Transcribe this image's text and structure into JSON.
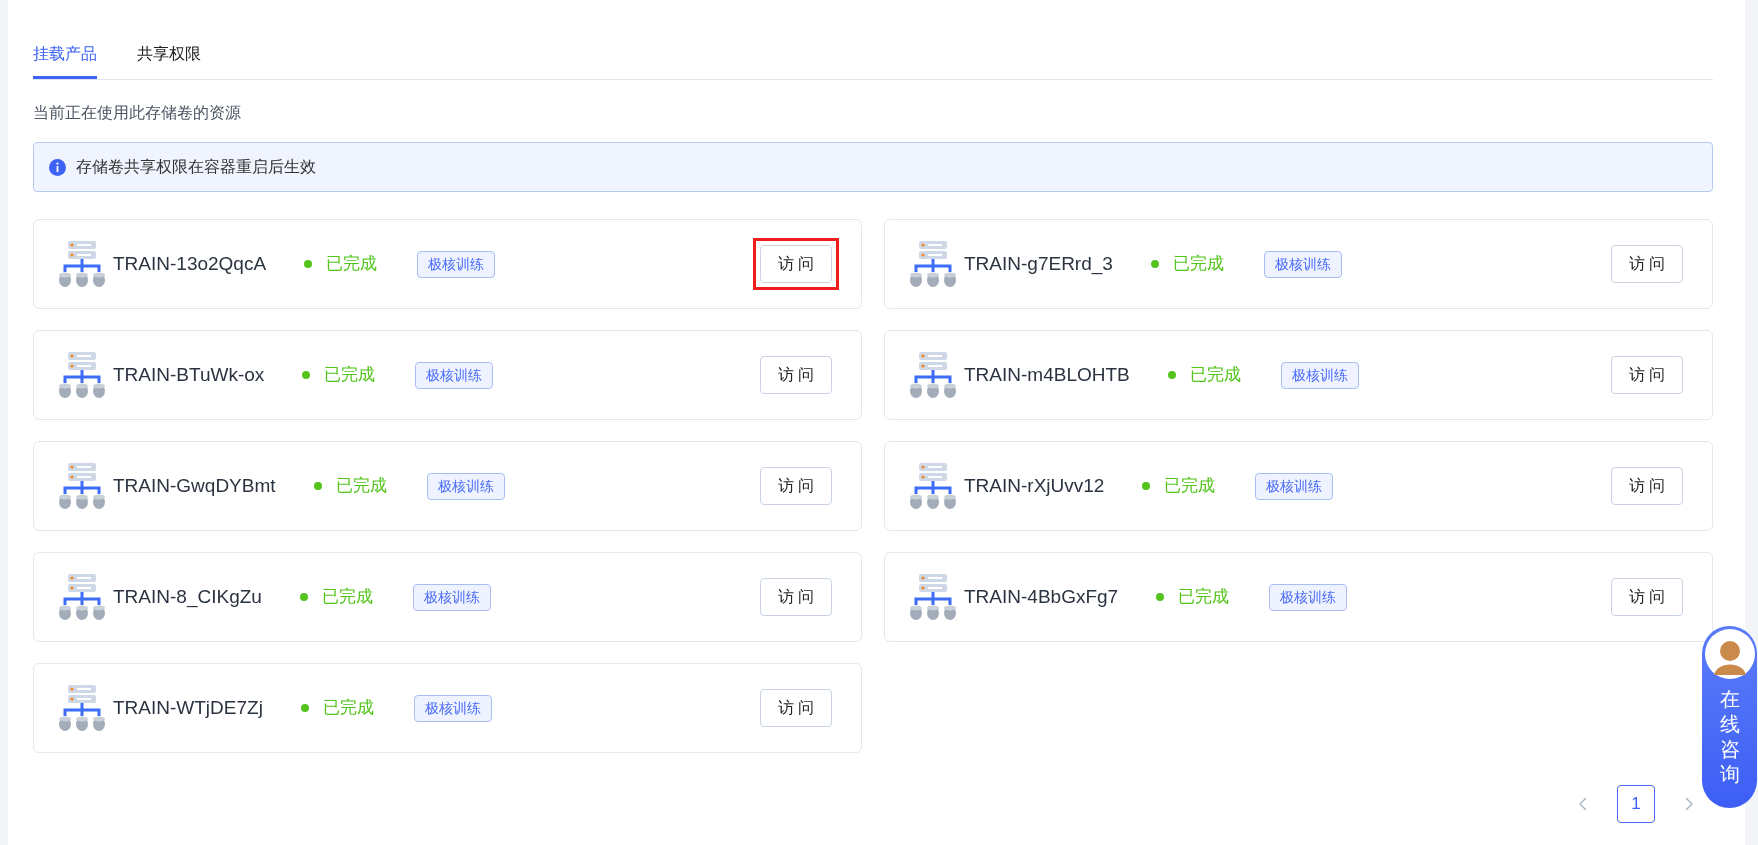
{
  "tabs": [
    {
      "label": "挂载产品",
      "selected": true
    },
    {
      "label": "共享权限",
      "selected": false
    }
  ],
  "subtitle": "当前正在使用此存储卷的资源",
  "alert": {
    "text": "存储卷共享权限在容器重启后生效"
  },
  "resources": [
    {
      "name": "TRAIN-13o2QqcA",
      "status": "已完成",
      "tag": "极核训练",
      "button": "访 问",
      "highlighted": true
    },
    {
      "name": "TRAIN-g7ERrd_3",
      "status": "已完成",
      "tag": "极核训练",
      "button": "访 问",
      "highlighted": false
    },
    {
      "name": "TRAIN-BTuWk-ox",
      "status": "已完成",
      "tag": "极核训练",
      "button": "访 问",
      "highlighted": false
    },
    {
      "name": "TRAIN-m4BLOHTB",
      "status": "已完成",
      "tag": "极核训练",
      "button": "访 问",
      "highlighted": false
    },
    {
      "name": "TRAIN-GwqDYBmt",
      "status": "已完成",
      "tag": "极核训练",
      "button": "访 问",
      "highlighted": false
    },
    {
      "name": "TRAIN-rXjUvv12",
      "status": "已完成",
      "tag": "极核训练",
      "button": "访 问",
      "highlighted": false
    },
    {
      "name": "TRAIN-8_CIKgZu",
      "status": "已完成",
      "tag": "极核训练",
      "button": "访 问",
      "highlighted": false
    },
    {
      "name": "TRAIN-4BbGxFg7",
      "status": "已完成",
      "tag": "极核训练",
      "button": "访 问",
      "highlighted": false
    },
    {
      "name": "TRAIN-WTjDE7Zj",
      "status": "已完成",
      "tag": "极核训练",
      "button": "访 问",
      "highlighted": false
    }
  ],
  "pagination": {
    "pages": [
      {
        "label": "1",
        "selected": true
      }
    ]
  },
  "chat_widget": {
    "label": "在线咨询"
  }
}
